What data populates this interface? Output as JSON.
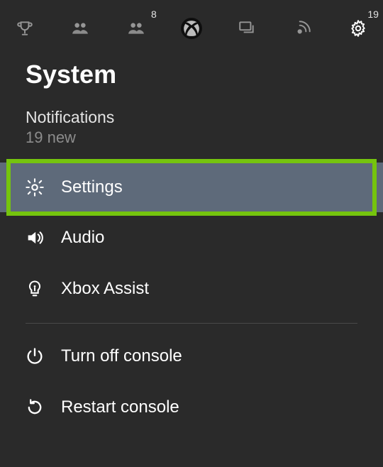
{
  "tabs": {
    "party_badge": "8",
    "settings_badge": "19"
  },
  "title": "System",
  "notifications": {
    "label": "Notifications",
    "count": "19 new"
  },
  "menu": {
    "settings": "Settings",
    "audio": "Audio",
    "assist": "Xbox Assist",
    "power_off": "Turn off console",
    "restart": "Restart console"
  }
}
